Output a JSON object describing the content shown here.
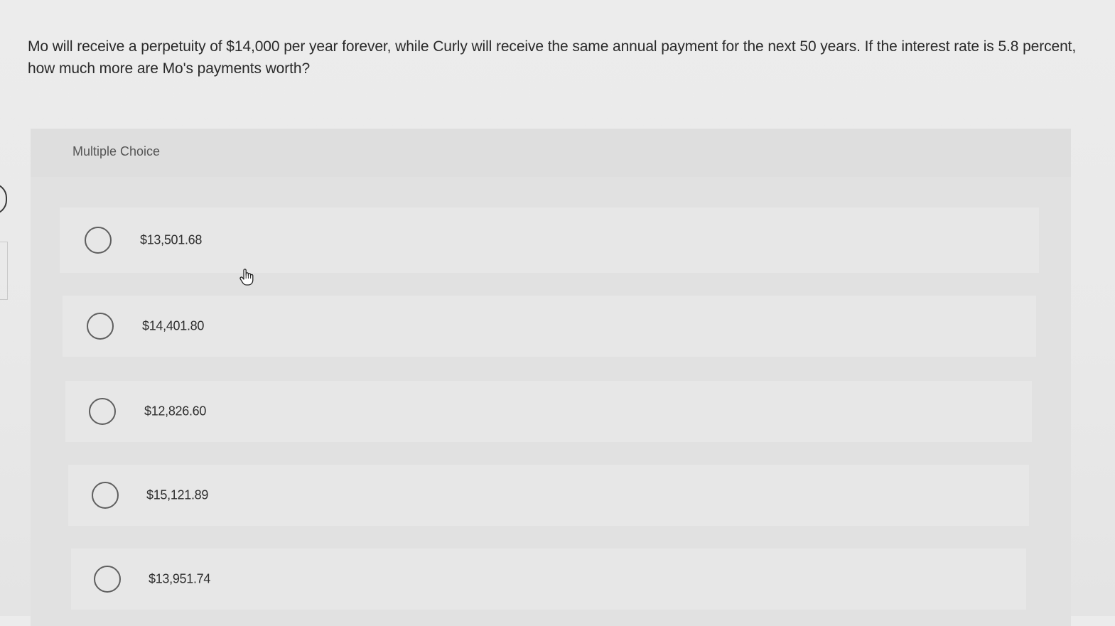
{
  "question": {
    "text": "Mo will receive a perpetuity of $14,000 per year forever, while Curly will receive the same annual payment for the next 50 years. If the interest rate is 5.8 percent, how much more are Mo's payments worth?"
  },
  "multiple_choice": {
    "label": "Multiple Choice",
    "options": [
      {
        "label": "$13,501.68",
        "selected": false
      },
      {
        "label": "$14,401.80",
        "selected": false
      },
      {
        "label": "$12,826.60",
        "selected": false
      },
      {
        "label": "$15,121.89",
        "selected": false
      },
      {
        "label": "$13,951.74",
        "selected": false
      }
    ]
  },
  "icons": {
    "cursor": "hand-pointer-icon",
    "radio": "radio-circle-icon"
  },
  "colors": {
    "background": "#ebebeb",
    "panel": "#e1e1e1",
    "option_row": "#e7e7e7",
    "text": "#2a2a2a",
    "radio_border": "#5f5f5f"
  }
}
